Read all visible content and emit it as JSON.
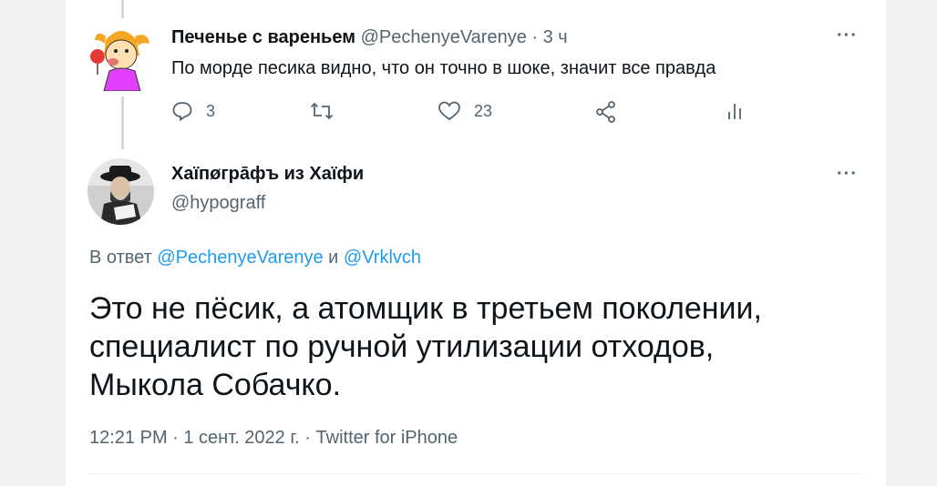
{
  "reply": {
    "author_name": "Печенье с вареньем",
    "handle": "@PechenyeVarenye",
    "separator": "·",
    "time": "3 ч",
    "text": "По морде песика видно, что он точно в шоке, значит все правда",
    "reply_count": "3",
    "like_count": "23",
    "more_label": "···"
  },
  "tweet": {
    "author_name": "Хаïпøгрāфъ из Хаïфи",
    "handle": "@hypograff",
    "reply_prefix": "В ответ",
    "reply_to_1": "@PechenyeVarenye",
    "reply_and": "и",
    "reply_to_2": "@Vrklvch",
    "text": "Это не пёсик, а атомщик в третьем поколении, специалист по ручной утилизации отходов, Мыкола Собачко.",
    "meta": "12:21 PM · 1 сент. 2022 г. · Twitter for iPhone",
    "more_label": "···"
  },
  "colors": {
    "link": "#1d9bf0",
    "muted": "#536471",
    "text": "#0f1419",
    "thread_line": "#cfd9de"
  },
  "icons": [
    "reply-icon",
    "retweet-icon",
    "like-icon",
    "share-icon",
    "stats-icon",
    "more-icon"
  ]
}
